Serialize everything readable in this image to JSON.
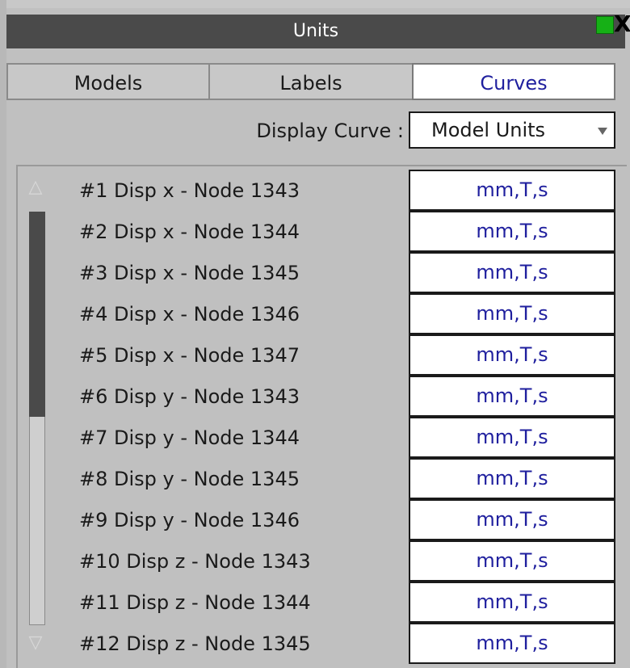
{
  "window": {
    "title": "Units",
    "close_glyph": "X",
    "green_button_icon": "green-square-icon"
  },
  "tabs": [
    {
      "label": "Models",
      "active": false
    },
    {
      "label": "Labels",
      "active": false
    },
    {
      "label": "Curves",
      "active": true
    }
  ],
  "display_curve": {
    "label": "Display Curve :",
    "value": "Model Units",
    "arrow_icon": "dropdown-arrow-icon"
  },
  "scrollbar": {
    "up_glyph": "△",
    "down_glyph": "▽",
    "thumb_fraction_visible": 0.5,
    "scroll_position_fraction": 0
  },
  "curves": [
    {
      "label": "#1 Disp x - Node 1343",
      "units": "mm,T,s"
    },
    {
      "label": "#2 Disp x - Node 1344",
      "units": "mm,T,s"
    },
    {
      "label": "#3 Disp x - Node 1345",
      "units": "mm,T,s"
    },
    {
      "label": "#4 Disp x - Node 1346",
      "units": "mm,T,s"
    },
    {
      "label": "#5 Disp x - Node 1347",
      "units": "mm,T,s"
    },
    {
      "label": "#6 Disp y - Node 1343",
      "units": "mm,T,s"
    },
    {
      "label": "#7 Disp y - Node 1344",
      "units": "mm,T,s"
    },
    {
      "label": "#8 Disp y - Node 1345",
      "units": "mm,T,s"
    },
    {
      "label": "#9 Disp y - Node 1346",
      "units": "mm,T,s"
    },
    {
      "label": "#10 Disp z - Node 1343",
      "units": "mm,T,s"
    },
    {
      "label": "#11 Disp z - Node 1344",
      "units": "mm,T,s"
    },
    {
      "label": "#12 Disp z - Node 1345",
      "units": "mm,T,s"
    }
  ],
  "colors": {
    "title_bar": "#4a4a4a",
    "panel": "#c0c0c0",
    "active_tab_text": "#1f1f9e",
    "units_text": "#1f1f9e",
    "green_button": "#16b016"
  }
}
